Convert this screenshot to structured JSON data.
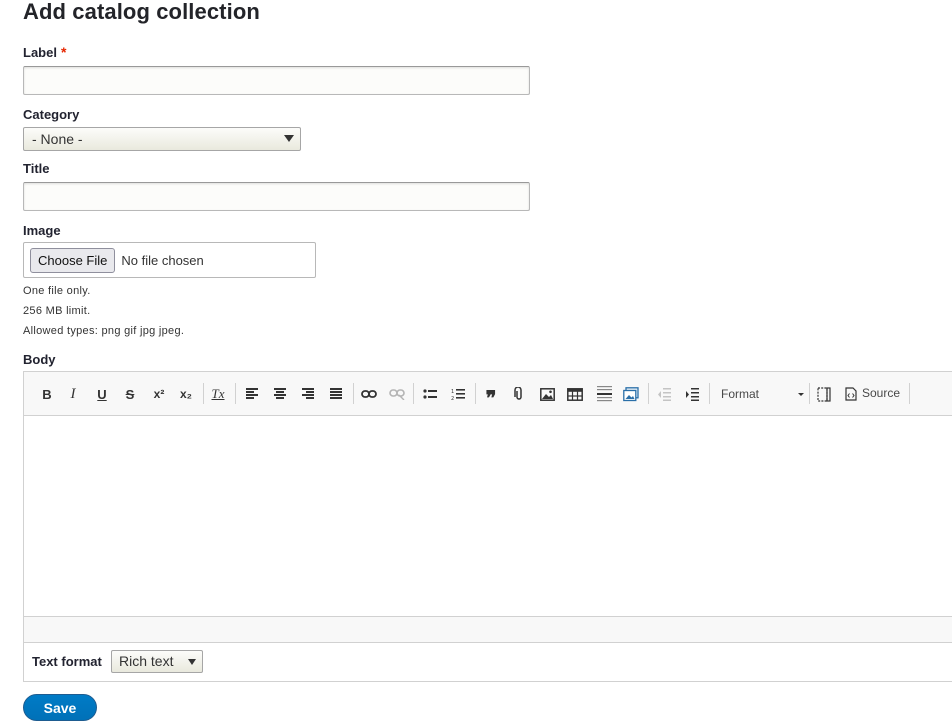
{
  "page": {
    "title": "Add catalog collection"
  },
  "form": {
    "label": {
      "label": "Label",
      "required_marker": "*",
      "value": ""
    },
    "category": {
      "label": "Category",
      "selected": "- None -"
    },
    "title": {
      "label": "Title",
      "value": ""
    },
    "image": {
      "label": "Image",
      "button_label": "Choose File",
      "status": "No file chosen",
      "descriptions": [
        "One file only.",
        "256 MB limit.",
        "Allowed types: png gif jpg jpeg."
      ]
    },
    "body": {
      "label": "Body",
      "toolbar": {
        "bold": "B",
        "italic": "I",
        "underline": "U",
        "strike": "S",
        "superscript": "x²",
        "subscript": "x₂",
        "remove_format": "Tx",
        "format_label": "Format",
        "source_label": "Source"
      },
      "text_format_label": "Text format",
      "text_format_selected": "Rich text"
    }
  },
  "actions": {
    "save_label": "Save"
  },
  "colors": {
    "required": "#e62600",
    "primary_button": "#0071b8"
  }
}
